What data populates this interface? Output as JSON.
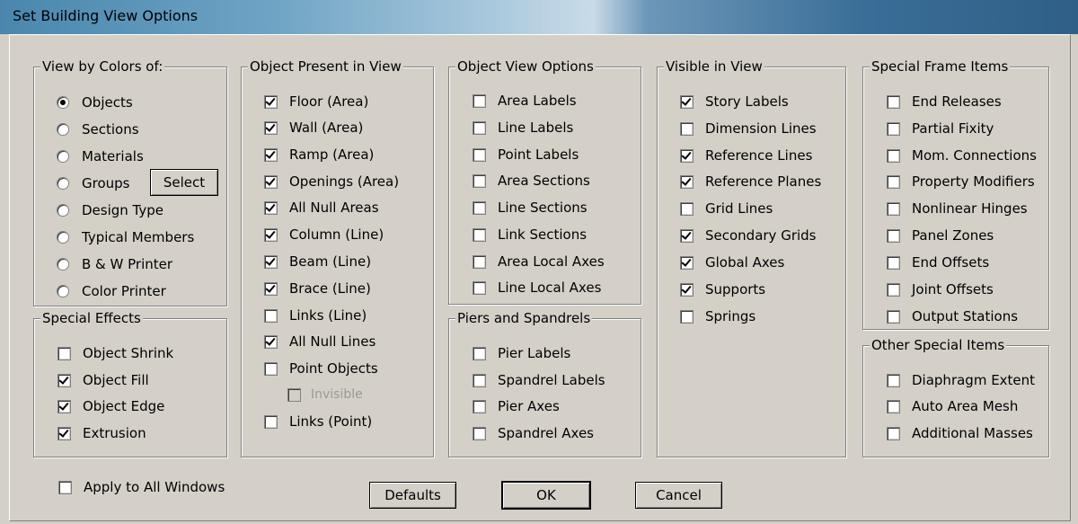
{
  "window": {
    "title": "Set Building View Options"
  },
  "view_by_colors": {
    "legend": "View by Colors of:",
    "options": [
      {
        "label": "Objects",
        "selected": true
      },
      {
        "label": "Sections",
        "selected": false
      },
      {
        "label": "Materials",
        "selected": false
      },
      {
        "label": "Groups",
        "selected": false
      },
      {
        "label": "Design Type",
        "selected": false
      },
      {
        "label": "Typical Members",
        "selected": false
      },
      {
        "label": "B & W Printer",
        "selected": false
      },
      {
        "label": "Color Printer",
        "selected": false
      }
    ],
    "select_button": "Select"
  },
  "special_effects": {
    "legend": "Special Effects",
    "items": [
      {
        "label": "Object Shrink",
        "checked": false
      },
      {
        "label": "Object Fill",
        "checked": true
      },
      {
        "label": "Object Edge",
        "checked": true
      },
      {
        "label": "Extrusion",
        "checked": true
      }
    ]
  },
  "object_present": {
    "legend": "Object Present in View",
    "items": [
      {
        "label": "Floor (Area)",
        "checked": true
      },
      {
        "label": "Wall (Area)",
        "checked": true
      },
      {
        "label": "Ramp (Area)",
        "checked": true
      },
      {
        "label": "Openings (Area)",
        "checked": true
      },
      {
        "label": "All Null Areas",
        "checked": true
      },
      {
        "label": "Column (Line)",
        "checked": true
      },
      {
        "label": "Beam (Line)",
        "checked": true
      },
      {
        "label": "Brace (Line)",
        "checked": true
      },
      {
        "label": "Links (Line)",
        "checked": false
      },
      {
        "label": "All Null Lines",
        "checked": true
      },
      {
        "label": "Point Objects",
        "checked": false
      },
      {
        "label": "Invisible",
        "checked": false,
        "disabled": true
      },
      {
        "label": "Links (Point)",
        "checked": false
      }
    ]
  },
  "object_view_options": {
    "legend": "Object View Options",
    "items": [
      {
        "label": "Area Labels",
        "checked": false
      },
      {
        "label": "Line Labels",
        "checked": false
      },
      {
        "label": "Point Labels",
        "checked": false
      },
      {
        "label": "Area Sections",
        "checked": false
      },
      {
        "label": "Line Sections",
        "checked": false
      },
      {
        "label": "Link Sections",
        "checked": false
      },
      {
        "label": "Area Local Axes",
        "checked": false
      },
      {
        "label": "Line Local Axes",
        "checked": false
      }
    ]
  },
  "piers_spandrels": {
    "legend": "Piers and Spandrels",
    "items": [
      {
        "label": "Pier Labels",
        "checked": false
      },
      {
        "label": "Spandrel Labels",
        "checked": false
      },
      {
        "label": "Pier Axes",
        "checked": false
      },
      {
        "label": "Spandrel Axes",
        "checked": false
      }
    ]
  },
  "visible_in_view": {
    "legend": "Visible in View",
    "items": [
      {
        "label": "Story Labels",
        "checked": true
      },
      {
        "label": "Dimension Lines",
        "checked": false
      },
      {
        "label": "Reference Lines",
        "checked": true
      },
      {
        "label": "Reference Planes",
        "checked": true
      },
      {
        "label": "Grid Lines",
        "checked": false
      },
      {
        "label": "Secondary Grids",
        "checked": true
      },
      {
        "label": "Global Axes",
        "checked": true
      },
      {
        "label": "Supports",
        "checked": true
      },
      {
        "label": "Springs",
        "checked": false
      }
    ]
  },
  "special_frame_items": {
    "legend": "Special Frame Items",
    "items": [
      {
        "label": "End Releases",
        "checked": false
      },
      {
        "label": "Partial Fixity",
        "checked": false
      },
      {
        "label": "Mom. Connections",
        "checked": false
      },
      {
        "label": "Property Modifiers",
        "checked": false
      },
      {
        "label": "Nonlinear Hinges",
        "checked": false
      },
      {
        "label": "Panel Zones",
        "checked": false
      },
      {
        "label": "End Offsets",
        "checked": false
      },
      {
        "label": "Joint Offsets",
        "checked": false
      },
      {
        "label": "Output Stations",
        "checked": false
      }
    ]
  },
  "other_special_items": {
    "legend": "Other Special Items",
    "items": [
      {
        "label": "Diaphragm Extent",
        "checked": false
      },
      {
        "label": "Auto Area Mesh",
        "checked": false
      },
      {
        "label": "Additional Masses",
        "checked": false
      }
    ]
  },
  "apply_all": {
    "label": "Apply to All Windows",
    "checked": false
  },
  "buttons": {
    "defaults": "Defaults",
    "ok": "OK",
    "cancel": "Cancel"
  }
}
